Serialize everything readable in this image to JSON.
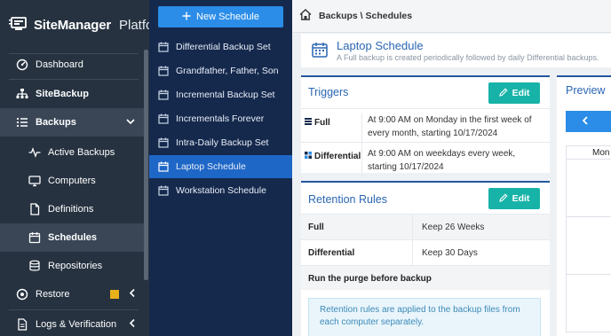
{
  "brand": {
    "name": "SiteManager",
    "suffix": "Platform"
  },
  "nav": [
    {
      "id": "dashboard",
      "label": "Dashboard",
      "icon": "dashboard-icon",
      "bold": false,
      "sub": false,
      "active": false
    },
    {
      "id": "sitebackup",
      "label": "SiteBackup",
      "icon": "sitebackup-icon",
      "bold": true,
      "sub": false,
      "active": false
    },
    {
      "id": "backups",
      "label": "Backups",
      "icon": "list-icon",
      "bold": true,
      "sub": false,
      "active": true
    },
    {
      "id": "active-backups",
      "label": "Active Backups",
      "icon": "activity-icon",
      "bold": false,
      "sub": true,
      "active": false
    },
    {
      "id": "computers",
      "label": "Computers",
      "icon": "monitor-icon",
      "bold": false,
      "sub": true,
      "active": false
    },
    {
      "id": "definitions",
      "label": "Definitions",
      "icon": "file-icon",
      "bold": false,
      "sub": true,
      "active": false
    },
    {
      "id": "schedules",
      "label": "Schedules",
      "icon": "calendar-icon",
      "bold": true,
      "sub": true,
      "active": true
    },
    {
      "id": "repositories",
      "label": "Repositories",
      "icon": "database-icon",
      "bold": false,
      "sub": true,
      "active": false
    },
    {
      "id": "restore",
      "label": "Restore",
      "icon": "restore-icon",
      "bold": false,
      "sub": false,
      "active": false
    },
    {
      "id": "logs",
      "label": "Logs & Verification",
      "icon": "log-icon",
      "bold": false,
      "sub": false,
      "active": false
    }
  ],
  "schedules": {
    "new_button": "New Schedule",
    "items": [
      "Differential Backup Set",
      "Grandfather, Father, Son",
      "Incremental Backup Set",
      "Incrementals Forever",
      "Intra-Daily Backup Set",
      "Laptop Schedule",
      "Workstation Schedule"
    ],
    "active_index": 5
  },
  "breadcrumb": "Backups \\ Schedules",
  "header": {
    "title": "Laptop Schedule",
    "subtitle": "A Full backup is created periodically followed by daily Differential backups."
  },
  "triggers": {
    "title": "Triggers",
    "edit_label": "Edit",
    "rows": [
      {
        "label": "Full",
        "icon": "full-icon",
        "value": "At 9:00 AM on Monday in the first week of every month, starting 10/17/2024"
      },
      {
        "label": "Differential",
        "icon": "differential-icon",
        "value": "At 9:00 AM on weekdays every week, starting 10/17/2024"
      }
    ]
  },
  "retention": {
    "title": "Retention Rules",
    "edit_label": "Edit",
    "rows": [
      {
        "label": "Full",
        "value": "Keep 26 Weeks"
      },
      {
        "label": "Differential",
        "value": "Keep 30 Days"
      }
    ],
    "purge_label": "Run the purge before backup",
    "info": "Retention rules are applied to the backup files from each computer separately."
  },
  "preview": {
    "title": "Preview",
    "day_header": "Mon"
  }
}
